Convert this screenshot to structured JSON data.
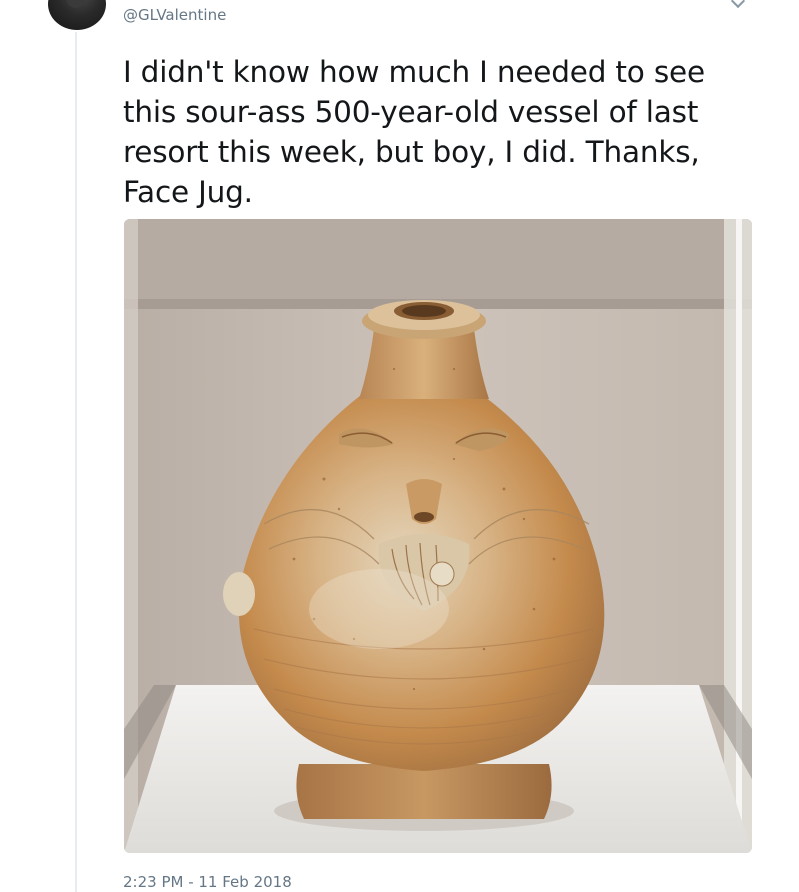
{
  "tweet": {
    "handle": "@GLValentine",
    "text": "I didn't know how much I needed to see this sour-ass 500-year-old vessel of last resort this week, but boy, I did. Thanks, Face Jug.",
    "timestamp": "2:23 PM - 11 Feb 2018",
    "media": {
      "icon": "photo-face-jug"
    }
  },
  "icons": {
    "avatar": "user-avatar",
    "menu": "chevron-down-icon"
  },
  "colors": {
    "text": "#14171a",
    "secondary": "#657786",
    "thread_line": "#e6ecf0"
  }
}
